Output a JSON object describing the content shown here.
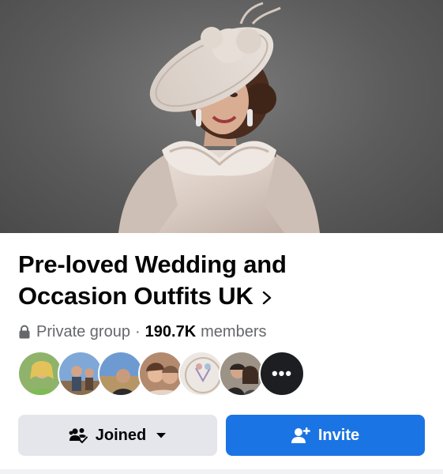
{
  "group": {
    "name": "Pre-loved Wedding and Occasion Outfits UK",
    "name_line1": "Pre-loved Wedding and",
    "name_line2": "Occasion Outfits UK",
    "privacy": "Private group",
    "separator": "·",
    "member_count": "190.7K",
    "member_label": "members"
  },
  "cover": {
    "alt": "Cover photo: woman in pale satin dress and wide-brim fascinator hat"
  },
  "icons": {
    "chevron": "chevron-right-icon",
    "lock": "lock-icon",
    "joined": "people-check-icon",
    "caret": "caret-down-icon",
    "invite": "add-person-icon",
    "more": "more-dots-icon"
  },
  "avatars": [
    {
      "name": "member-avatar-1"
    },
    {
      "name": "member-avatar-2"
    },
    {
      "name": "member-avatar-3"
    },
    {
      "name": "member-avatar-4"
    },
    {
      "name": "member-avatar-5"
    },
    {
      "name": "member-avatar-6"
    }
  ],
  "more_avatars_label": "•••",
  "buttons": {
    "joined": "Joined",
    "invite": "Invite"
  },
  "colors": {
    "primary_blue": "#1b74e4",
    "secondary_gray": "#e4e6eb",
    "text_primary": "#050505",
    "text_secondary": "#65676b"
  }
}
